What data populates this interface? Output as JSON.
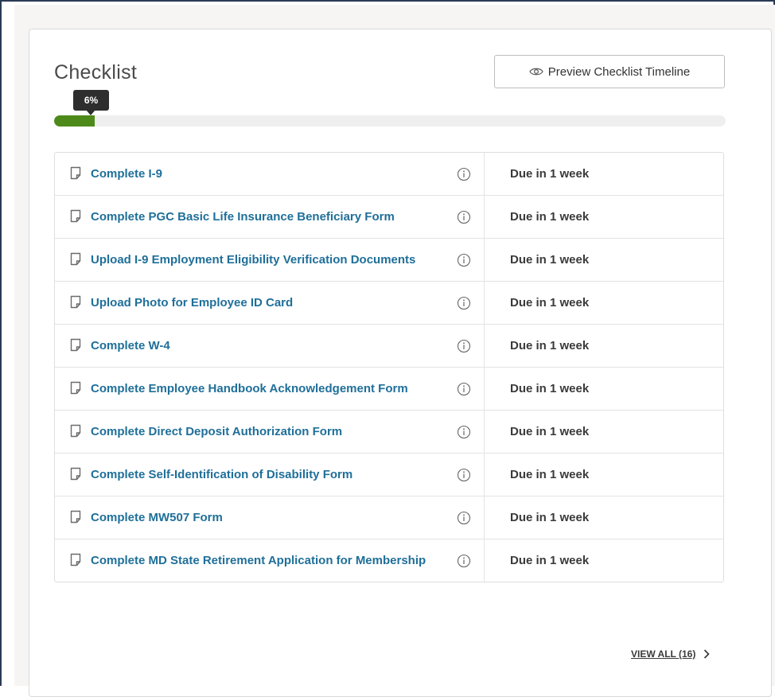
{
  "checklist": {
    "title": "Checklist",
    "preview_button_label": "Preview Checklist Timeline",
    "progress": {
      "percent_label": "6%",
      "value": 0.06,
      "fill_color": "#4e8a1a"
    },
    "items": [
      {
        "label": "Complete I-9",
        "due": "Due in 1 week"
      },
      {
        "label": "Complete PGC Basic Life Insurance Beneficiary Form",
        "due": "Due in 1 week"
      },
      {
        "label": "Upload I-9 Employment Eligibility Verification Documents",
        "due": "Due in 1 week"
      },
      {
        "label": "Upload Photo for Employee ID Card",
        "due": "Due in 1 week"
      },
      {
        "label": "Complete W-4",
        "due": "Due in 1 week"
      },
      {
        "label": "Complete Employee Handbook Acknowledgement Form",
        "due": "Due in 1 week"
      },
      {
        "label": "Complete Direct Deposit Authorization Form",
        "due": "Due in 1 week"
      },
      {
        "label": "Complete Self-Identification of Disability Form",
        "due": "Due in 1 week"
      },
      {
        "label": "Complete MW507 Form",
        "due": "Due in 1 week"
      },
      {
        "label": "Complete MD State Retirement Application for Membership",
        "due": "Due in 1 week"
      }
    ],
    "view_all_label": "VIEW ALL (16)",
    "link_color": "#1f6f99"
  }
}
